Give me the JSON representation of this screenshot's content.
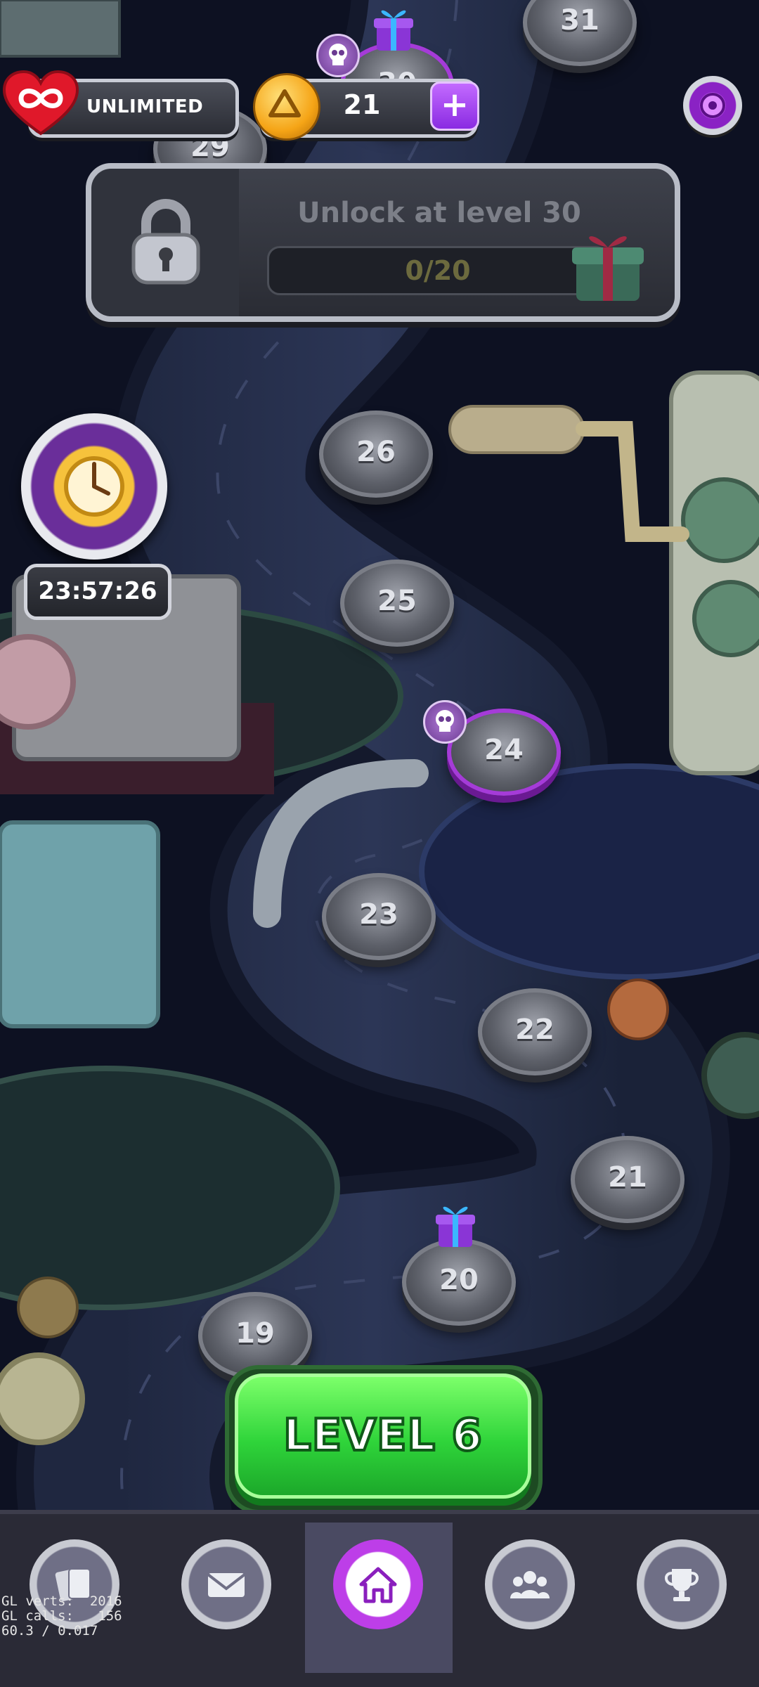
{
  "hud": {
    "lives_label": "UNLIMITED",
    "lives_icon": "infinity-heart-icon",
    "coins": "21",
    "plus_label": "+",
    "settings_icon": "gear-icon"
  },
  "unlock": {
    "title": "Unlock at level 30",
    "progress_text": "0/20",
    "progress_value": 0,
    "progress_max": 20
  },
  "levels": [
    {
      "num": "19"
    },
    {
      "num": "20",
      "reward": "gift"
    },
    {
      "num": "21"
    },
    {
      "num": "22"
    },
    {
      "num": "23"
    },
    {
      "num": "24",
      "difficulty": "hard"
    },
    {
      "num": "25"
    },
    {
      "num": "26"
    },
    {
      "num": "29"
    },
    {
      "num": "30",
      "reward": "gift",
      "difficulty": "hard"
    },
    {
      "num": "31"
    }
  ],
  "event_timer": "23:57:26",
  "play_button": "LEVEL 6",
  "nav": [
    {
      "name": "cards",
      "icon": "cards-icon",
      "active": false
    },
    {
      "name": "inbox",
      "icon": "envelope-icon",
      "active": false
    },
    {
      "name": "home",
      "icon": "home-icon",
      "active": true
    },
    {
      "name": "team",
      "icon": "team-icon",
      "active": false
    },
    {
      "name": "leaderboard",
      "icon": "trophy-icon",
      "active": false
    }
  ],
  "debug_overlay": "GL verts:  2016\nGL calls:   156\n60.3 / 0.017",
  "colors": {
    "play_green": "#2fd43a",
    "accent_purple": "#a53bd8",
    "coin_gold": "#f5a416",
    "heart_red": "#e0182a"
  }
}
